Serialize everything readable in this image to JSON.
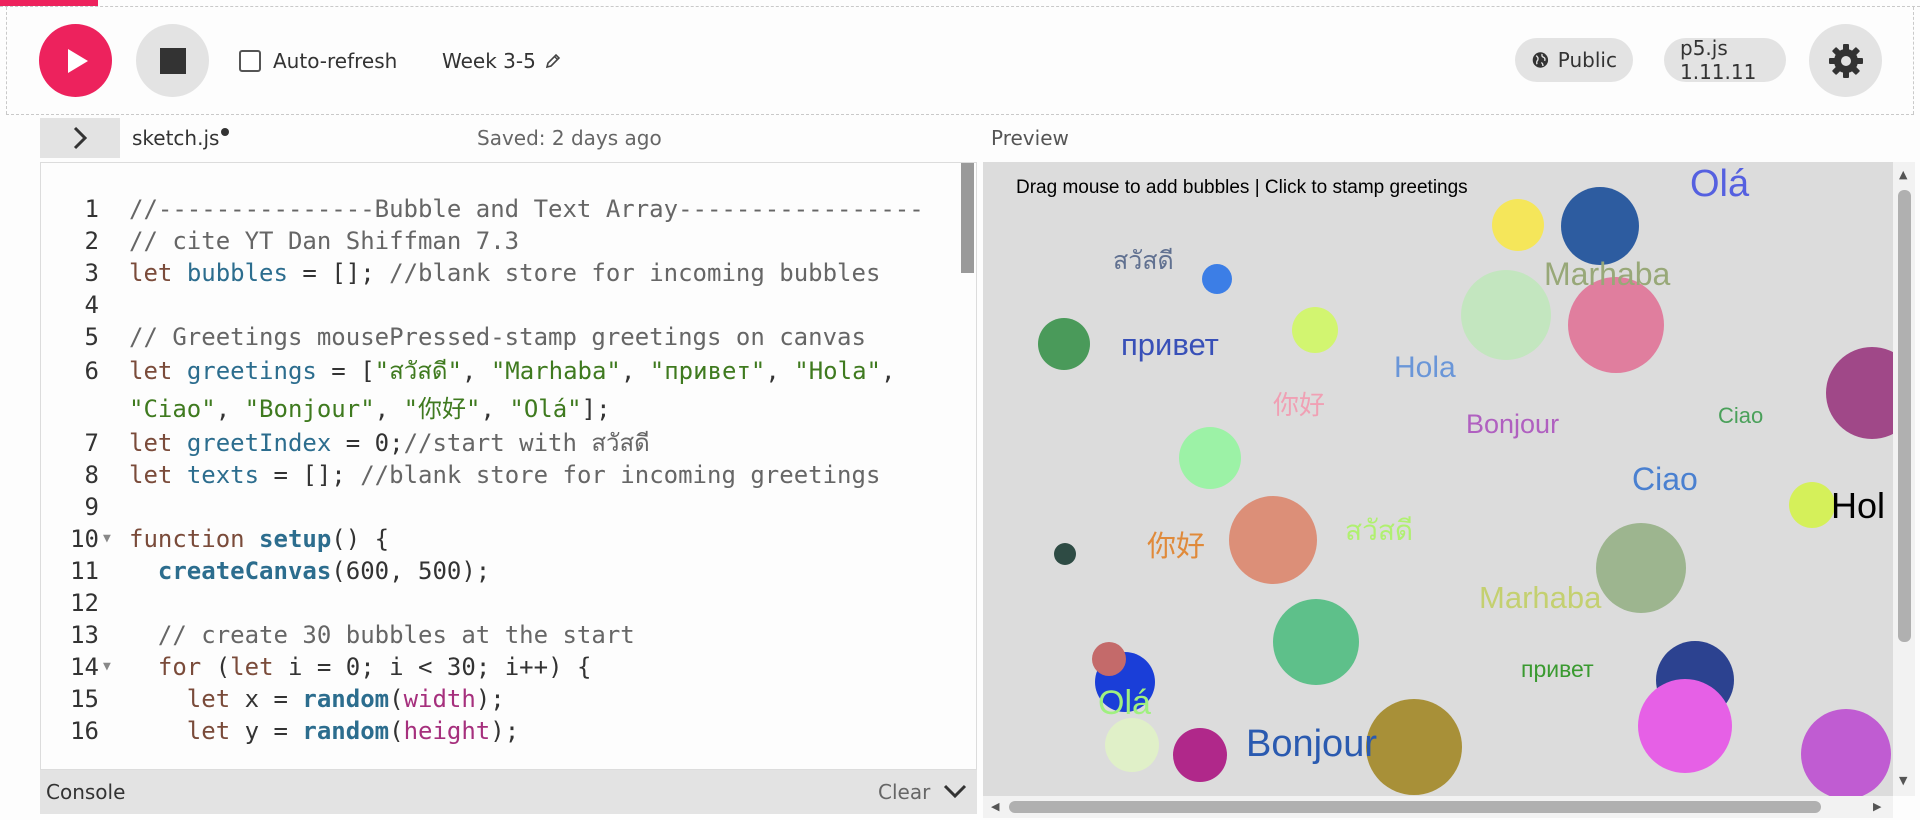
{
  "toolbar": {
    "auto_refresh_label": "Auto-refresh",
    "sketch_name": "Week 3-5",
    "visibility_label": "Public",
    "version_label": "p5.js 1.11.11"
  },
  "editor": {
    "file_name": "sketch.js",
    "saved_status": "Saved: 2 days ago",
    "lines": [
      {
        "n": "1",
        "text": "//---------------Bubble and Text Array-----------------"
      },
      {
        "n": "2",
        "text": "// cite YT Dan Shiffman 7.3"
      },
      {
        "n": "3",
        "text": "let bubbles = []; //blank store for incoming bubbles"
      },
      {
        "n": "4",
        "text": ""
      },
      {
        "n": "5",
        "text": "// Greetings mousePressed-stamp greetings on canvas"
      },
      {
        "n": "6",
        "text": "let greetings = [\"สวัสดี\", \"Marhaba\", \"привет\", \"Hola\","
      },
      {
        "n": "",
        "text": "\"Ciao\", \"Bonjour\", \"你好\", \"Olá\"];"
      },
      {
        "n": "7",
        "text": "let greetIndex = 0;//start with สวัสดี"
      },
      {
        "n": "8",
        "text": "let texts = []; //blank store for incoming greetings"
      },
      {
        "n": "9",
        "text": ""
      },
      {
        "n": "10",
        "text": "function setup() {"
      },
      {
        "n": "11",
        "text": "  createCanvas(600, 500);"
      },
      {
        "n": "12",
        "text": ""
      },
      {
        "n": "13",
        "text": "  // create 30 bubbles at the start"
      },
      {
        "n": "14",
        "text": "  for (let i = 0; i < 30; i++) {"
      },
      {
        "n": "15",
        "text": "    let x = random(width);"
      },
      {
        "n": "16",
        "text": "    let y = random(height);"
      }
    ]
  },
  "console": {
    "label": "Console",
    "clear_label": "Clear"
  },
  "preview": {
    "label": "Preview",
    "hud_text": "Drag mouse to add bubbles | Click to stamp greetings",
    "greetings_on_canvas": [
      "Olá",
      "สวัสดี",
      "Marhaba",
      "привет",
      "Hola",
      "你好",
      "Bonjour",
      "Ciao",
      "Ciao",
      "Hol",
      "你好",
      "สวัสดี",
      "Marhaba",
      "привет",
      "Olá",
      "Bonjour"
    ]
  },
  "colors": {
    "accent": "#ed225d",
    "button_gray": "#e3e3e3",
    "canvas_bg": "#dcdcdc"
  }
}
